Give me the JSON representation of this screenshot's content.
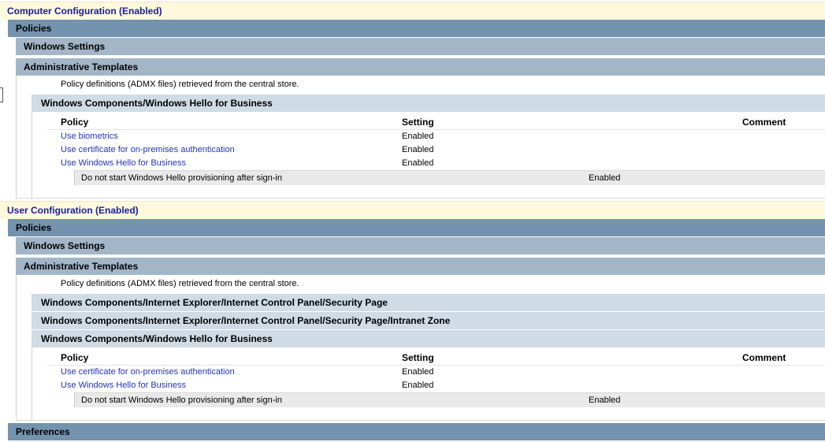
{
  "computer": {
    "title": "Computer Configuration (Enabled)",
    "policies": "Policies",
    "windows_settings": "Windows Settings",
    "admin_templates": "Administrative Templates",
    "admx_note": "Policy definitions (ADMX files) retrieved from the central store.",
    "category": "Windows Components/Windows Hello for Business",
    "columns": {
      "policy": "Policy",
      "setting": "Setting",
      "comment": "Comment"
    },
    "rows": [
      {
        "policy": "Use biometrics",
        "setting": "Enabled"
      },
      {
        "policy": "Use certificate for on-premises authentication",
        "setting": "Enabled"
      },
      {
        "policy": "Use Windows Hello for Business",
        "setting": "Enabled"
      }
    ],
    "subrow": {
      "label": "Do not start Windows Hello provisioning after sign-in",
      "value": "Enabled"
    }
  },
  "user": {
    "title": "User Configuration (Enabled)",
    "policies": "Policies",
    "windows_settings": "Windows Settings",
    "admin_templates": "Administrative Templates",
    "admx_note": "Policy definitions (ADMX files) retrieved from the central store.",
    "categories": [
      "Windows Components/Internet Explorer/Internet Control Panel/Security Page",
      "Windows Components/Internet Explorer/Internet Control Panel/Security Page/Intranet Zone",
      "Windows Components/Windows Hello for Business"
    ],
    "columns": {
      "policy": "Policy",
      "setting": "Setting",
      "comment": "Comment"
    },
    "rows": [
      {
        "policy": "Use certificate for on-premises authentication",
        "setting": "Enabled"
      },
      {
        "policy": "Use Windows Hello for Business",
        "setting": "Enabled"
      }
    ],
    "subrow": {
      "label": "Do not start Windows Hello provisioning after sign-in",
      "value": "Enabled"
    },
    "preferences": "Preferences"
  },
  "colors": {
    "config_bg": "#fef9dc",
    "config_text": "#1a1aa6",
    "policies_bg": "#7493ae",
    "level2_bg": "#a3b6c8",
    "level3_bg": "#cfdbe5",
    "link": "#2233bb"
  }
}
